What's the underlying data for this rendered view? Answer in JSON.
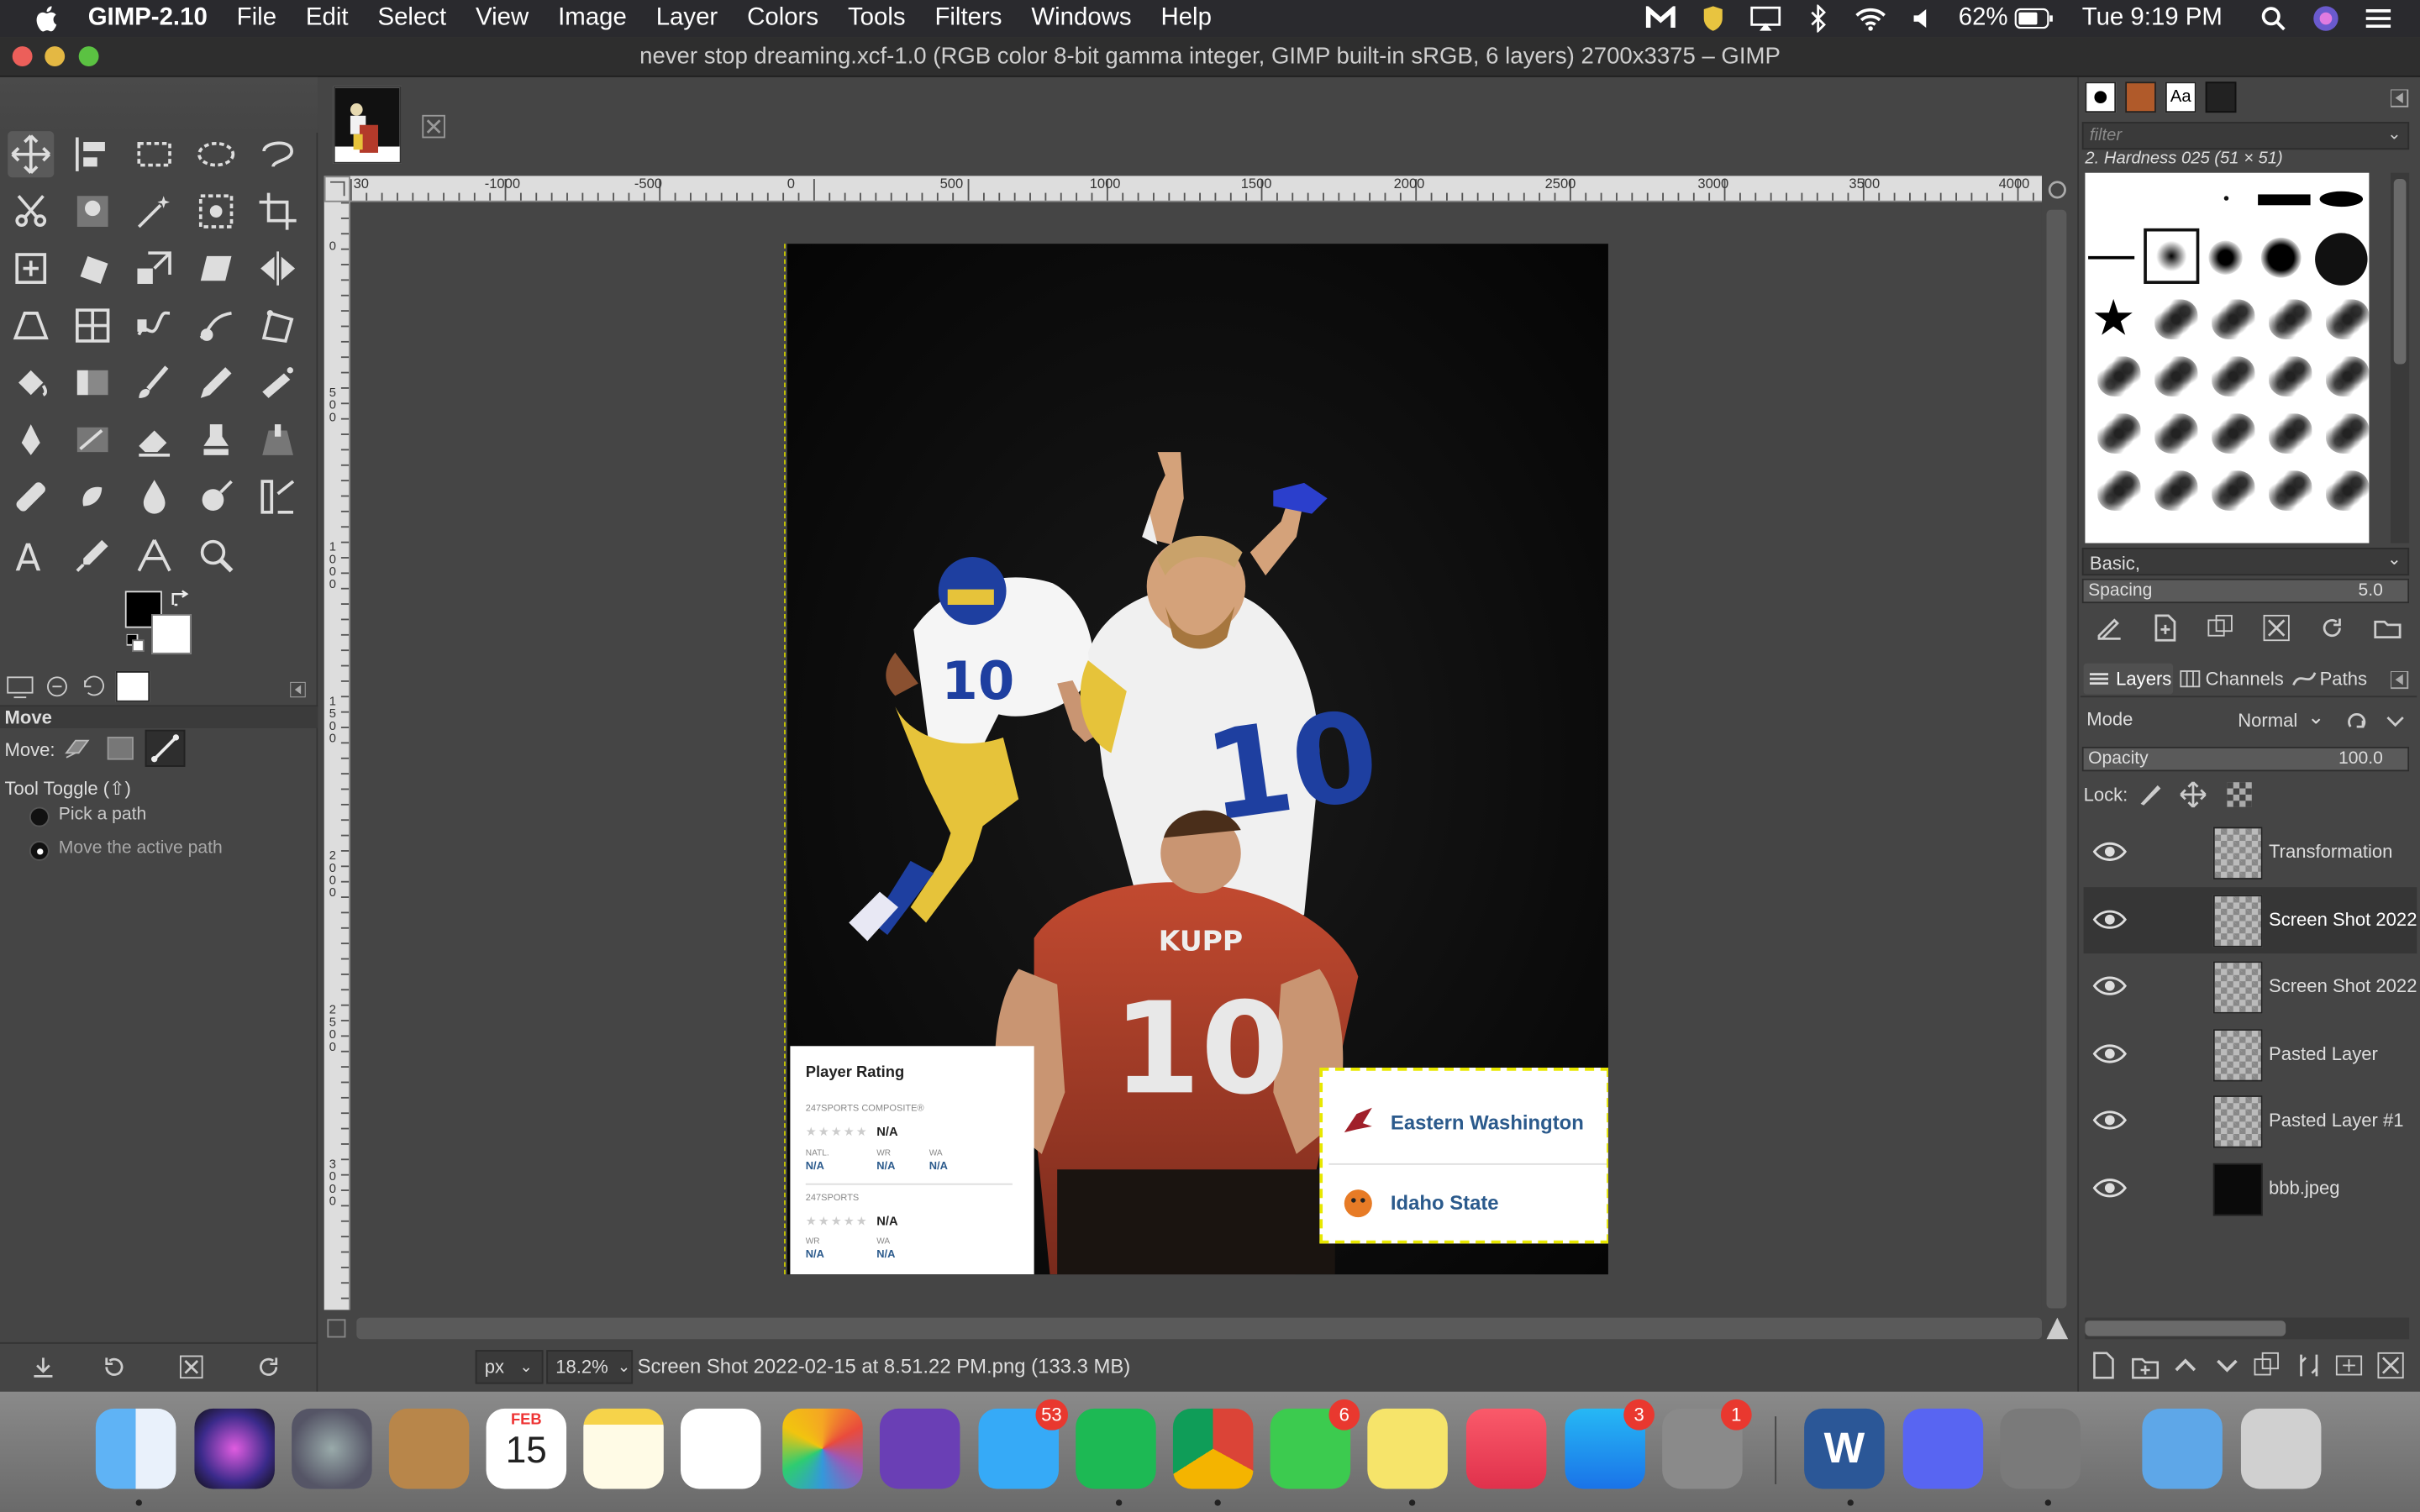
{
  "menubar": {
    "app_name": "GIMP-2.10",
    "menus": [
      "File",
      "Edit",
      "Select",
      "View",
      "Image",
      "Layer",
      "Colors",
      "Tools",
      "Filters",
      "Windows",
      "Help"
    ],
    "battery": "62%",
    "clock": "Tue 9:19 PM"
  },
  "window": {
    "title": "never stop dreaming.xcf-1.0 (RGB color 8-bit gamma integer, GIMP built-in sRGB, 6 layers) 2700x3375 – GIMP"
  },
  "tool_options": {
    "tool_name": "Move",
    "move_label": "Move:",
    "toggle_label": "Tool Toggle  (⇧)",
    "options": [
      "Pick a path",
      "Move the active path"
    ],
    "selected_option": 1
  },
  "ruler": {
    "h_labels": [
      "-1000",
      "-500",
      "0",
      "500",
      "1000",
      "1500",
      "2000",
      "2500",
      "3000",
      "3500",
      "4000"
    ],
    "h_origin_label": "30",
    "v_labels": [
      "0",
      "500",
      "1000",
      "1500",
      "2000",
      "2500",
      "3000"
    ]
  },
  "canvas_content": {
    "player_card": {
      "title": "Player Rating",
      "sub1": "247SPORTS COMPOSITE®",
      "rating1": "N/A",
      "cols1": [
        "NATL.",
        "WR",
        "WA"
      ],
      "vals1": [
        "N/A",
        "N/A",
        "N/A"
      ],
      "sub2": "247SPORTS",
      "rating2": "N/A",
      "cols2": [
        "WR",
        "WA"
      ],
      "vals2": [
        "N/A",
        "N/A"
      ]
    },
    "schools": [
      "Eastern Washington",
      "Idaho State"
    ],
    "jersey_name": "KUPP",
    "jersey_number": "10"
  },
  "status": {
    "unit": "px",
    "zoom": "18.2%",
    "message": "Screen Shot 2022-02-15 at 8.51.22 PM.png (133.3 MB)"
  },
  "brushes": {
    "filter_placeholder": "filter",
    "selected_brush": "2. Hardness 025 (51 × 51)",
    "preset": "Basic,",
    "spacing_label": "Spacing",
    "spacing_value": "5.0"
  },
  "layers_panel": {
    "tabs": [
      "Layers",
      "Channels",
      "Paths"
    ],
    "mode_label": "Mode",
    "mode_value": "Normal",
    "opacity_label": "Opacity",
    "opacity_value": "100.0",
    "lock_label": "Lock:",
    "layers": [
      {
        "name": "Transformation"
      },
      {
        "name": "Screen Shot 2022-"
      },
      {
        "name": "Screen Shot 2022-"
      },
      {
        "name": "Pasted Layer"
      },
      {
        "name": "Pasted Layer #1"
      },
      {
        "name": "bbb.jpeg"
      }
    ],
    "selected_index": 1
  },
  "dock": {
    "calendar_month": "FEB",
    "calendar_day": "15",
    "badges": {
      "messages": "53",
      "facetime": "6",
      "appstore": "3",
      "sysprefs": "1"
    }
  },
  "colors": {
    "menubar_bg": "#2a2a2e",
    "panel_bg": "#454545",
    "accent_blue": "#2b5a8c",
    "selection_yellow": "#e8e800"
  }
}
